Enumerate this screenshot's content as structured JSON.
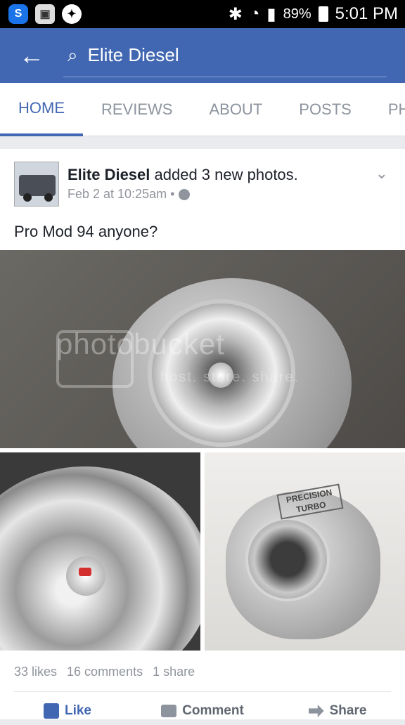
{
  "status_bar": {
    "battery": "89%",
    "time": "5:01 PM",
    "left_icons": [
      "s-app-icon",
      "photo-app-icon",
      "messenger-icon"
    ],
    "right_icons": [
      "bluetooth-icon",
      "wifi-icon",
      "signal-icon",
      "battery-icon"
    ]
  },
  "app_bar": {
    "back_icon": "back-arrow-icon",
    "search_icon": "search-icon",
    "search_text": "Elite Diesel"
  },
  "tabs": [
    "HOME",
    "REVIEWS",
    "ABOUT",
    "POSTS",
    "PHO"
  ],
  "active_tab": "HOME",
  "post": {
    "author": "Elite Diesel",
    "action": " added 3 new photos.",
    "time": "Feb 2 at 10:25am •",
    "text": "Pro Mod 94 anyone?",
    "photo_watermark": "photobucket",
    "photo_watermark_sub": "host. store. share.",
    "photo_right_label": "PRECISION TURBO",
    "stats": {
      "likes": "33 likes",
      "comments": "16 comments",
      "shares": "1 share"
    },
    "actions": {
      "like": "Like",
      "comment": "Comment",
      "share": "Share"
    }
  },
  "colors": {
    "brand": "#4267b2",
    "status_bar": "#000000",
    "muted_text": "#90949c"
  }
}
